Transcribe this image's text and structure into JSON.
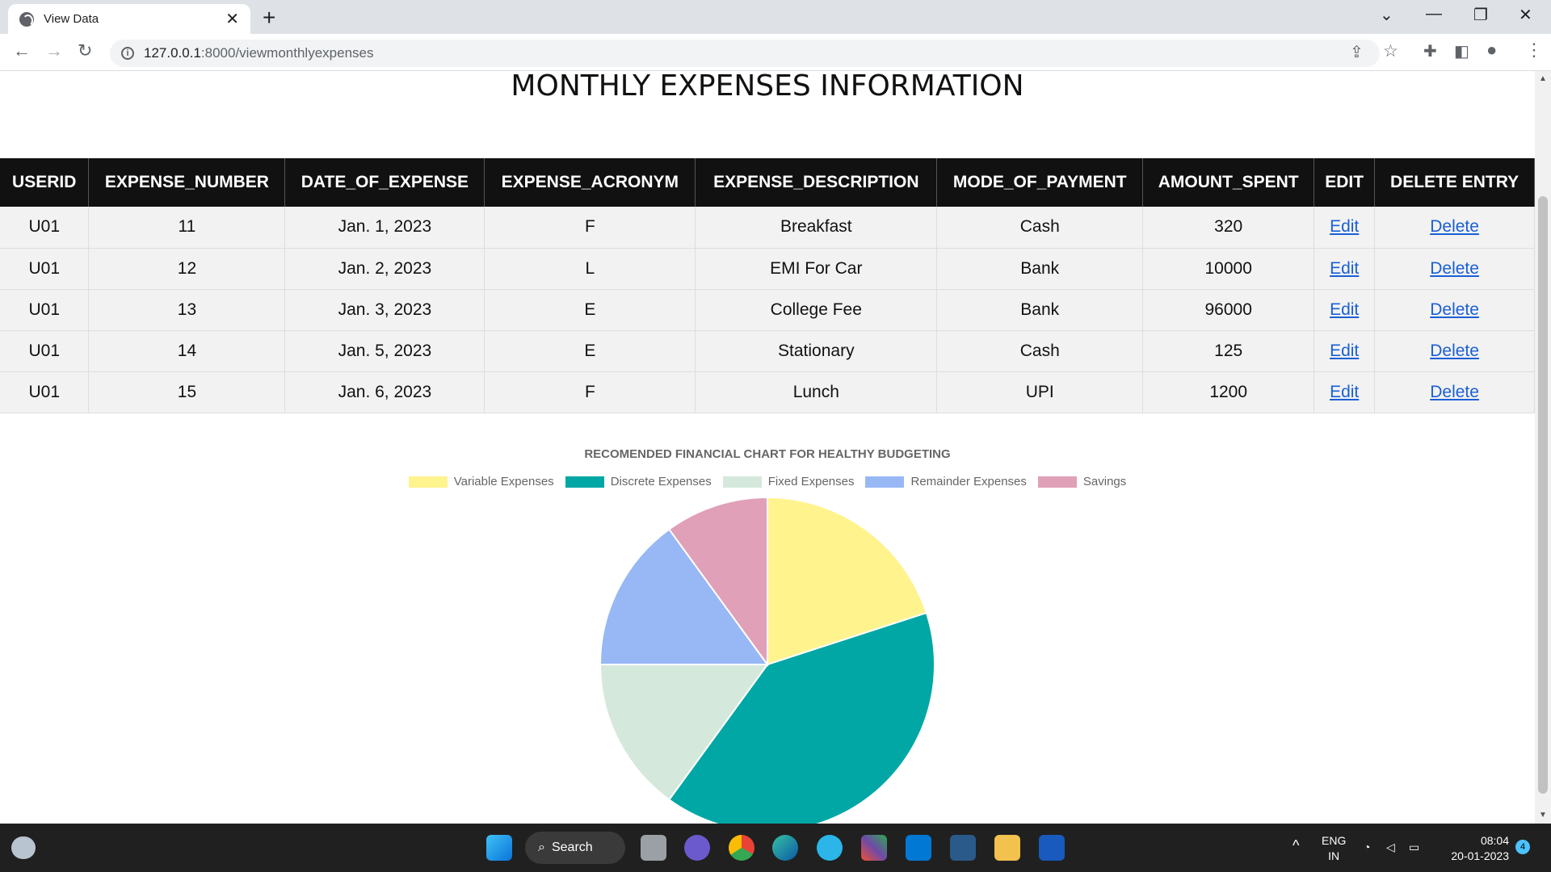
{
  "browser": {
    "tab_title": "View Data",
    "url_host": "127.0.0.1",
    "url_path": ":8000/viewmonthlyexpenses"
  },
  "page": {
    "heading": "MONTHLY EXPENSES INFORMATION",
    "columns": [
      "USERID",
      "EXPENSE_NUMBER",
      "DATE_OF_EXPENSE",
      "EXPENSE_ACRONYM",
      "EXPENSE_DESCRIPTION",
      "MODE_OF_PAYMENT",
      "AMOUNT_SPENT",
      "EDIT",
      "DELETE ENTRY"
    ],
    "rows": [
      {
        "userid": "U01",
        "number": "11",
        "date": "Jan. 1, 2023",
        "acronym": "F",
        "description": "Breakfast",
        "mode": "Cash",
        "amount": "320",
        "edit": "Edit",
        "delete": "Delete"
      },
      {
        "userid": "U01",
        "number": "12",
        "date": "Jan. 2, 2023",
        "acronym": "L",
        "description": "EMI For Car",
        "mode": "Bank",
        "amount": "10000",
        "edit": "Edit",
        "delete": "Delete"
      },
      {
        "userid": "U01",
        "number": "13",
        "date": "Jan. 3, 2023",
        "acronym": "E",
        "description": "College Fee",
        "mode": "Bank",
        "amount": "96000",
        "edit": "Edit",
        "delete": "Delete"
      },
      {
        "userid": "U01",
        "number": "14",
        "date": "Jan. 5, 2023",
        "acronym": "E",
        "description": "Stationary",
        "mode": "Cash",
        "amount": "125",
        "edit": "Edit",
        "delete": "Delete"
      },
      {
        "userid": "U01",
        "number": "15",
        "date": "Jan. 6, 2023",
        "acronym": "F",
        "description": "Lunch",
        "mode": "UPI",
        "amount": "1200",
        "edit": "Edit",
        "delete": "Delete"
      }
    ]
  },
  "chart_data": {
    "type": "pie",
    "title": "RECOMENDED FINANCIAL CHART FOR HEALTHY BUDGETING",
    "legend_position": "top",
    "categories": [
      "Variable Expenses",
      "Discrete Expenses",
      "Fixed Expenses",
      "Remainder Expenses",
      "Savings"
    ],
    "values": [
      20,
      40,
      15,
      15,
      10
    ],
    "colors": [
      "#fff38e",
      "#00a7a4",
      "#d5e8dc",
      "#98b8f5",
      "#e0a0b8"
    ]
  },
  "taskbar": {
    "search_label": "Search",
    "lang_top": "ENG",
    "lang_bottom": "IN",
    "time": "08:04",
    "date": "20-01-2023",
    "notifications": "4"
  }
}
